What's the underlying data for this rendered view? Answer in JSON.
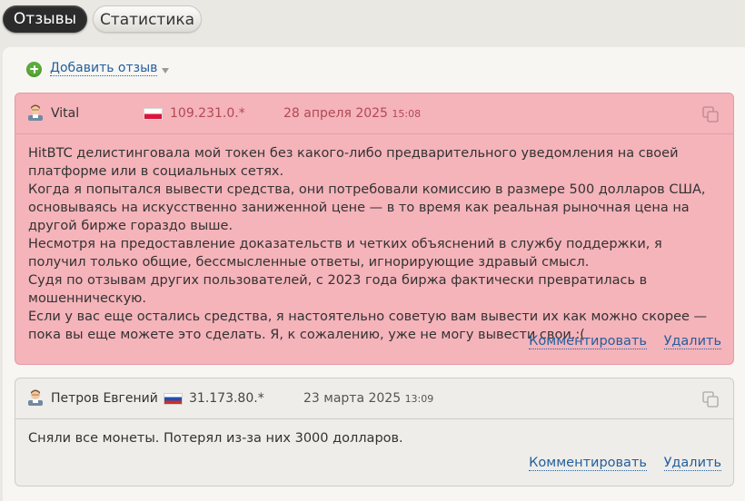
{
  "tabs": [
    {
      "label": "Отзывы",
      "active": true
    },
    {
      "label": "Статистика",
      "active": false
    }
  ],
  "add_review": {
    "label": "Добавить отзыв",
    "icon": "plus-circle-icon",
    "dropdown_icon": "caret-down-icon"
  },
  "reviews": [
    {
      "author": "Vital",
      "flag": "flag-poland-icon",
      "ip": "109.231.0.*",
      "date": "28 апреля 2025",
      "time": "15:08",
      "highlight_color": "#f5b3ba",
      "text": "HitBTC делистинговала мой токен без какого-либо предварительного уведомления на своей платформе или в социальных сетях.\nКогда я попытался вывести средства, они потребовали комиссию в размере 500 долларов США, основываясь на искусственно заниженной цене — в то время как реальная рыночная цена на другой бирже гораздо выше.\nНесмотря на предоставление доказательств и четких объяснений в службу поддержки, я получил только общие, бессмысленные ответы, игнорирующие здравый смысл.\nСудя по отзывам других пользователей, с 2023 года биржа фактически превратилась в мошенническую.\nЕсли у вас еще остались средства, я настоятельно советую вам вывести их как можно скорее — пока вы еще можете это сделать. Я, к сожалению, уже не могу вывести свои.:(",
      "comment_label": "Комментировать",
      "delete_label": "Удалить"
    },
    {
      "author": "Петров Евгений",
      "flag": "flag-russia-icon",
      "ip": "31.173.80.*",
      "date": "23 марта 2025",
      "time": "13:09",
      "text": "Сняли все монеты. Потерял из-за них 3000 долларов.",
      "comment_label": "Комментировать",
      "delete_label": "Удалить"
    }
  ],
  "colors": {
    "link": "#245f9c",
    "highlight": "#f5b3ba",
    "accent_green": "#5aac3a"
  }
}
